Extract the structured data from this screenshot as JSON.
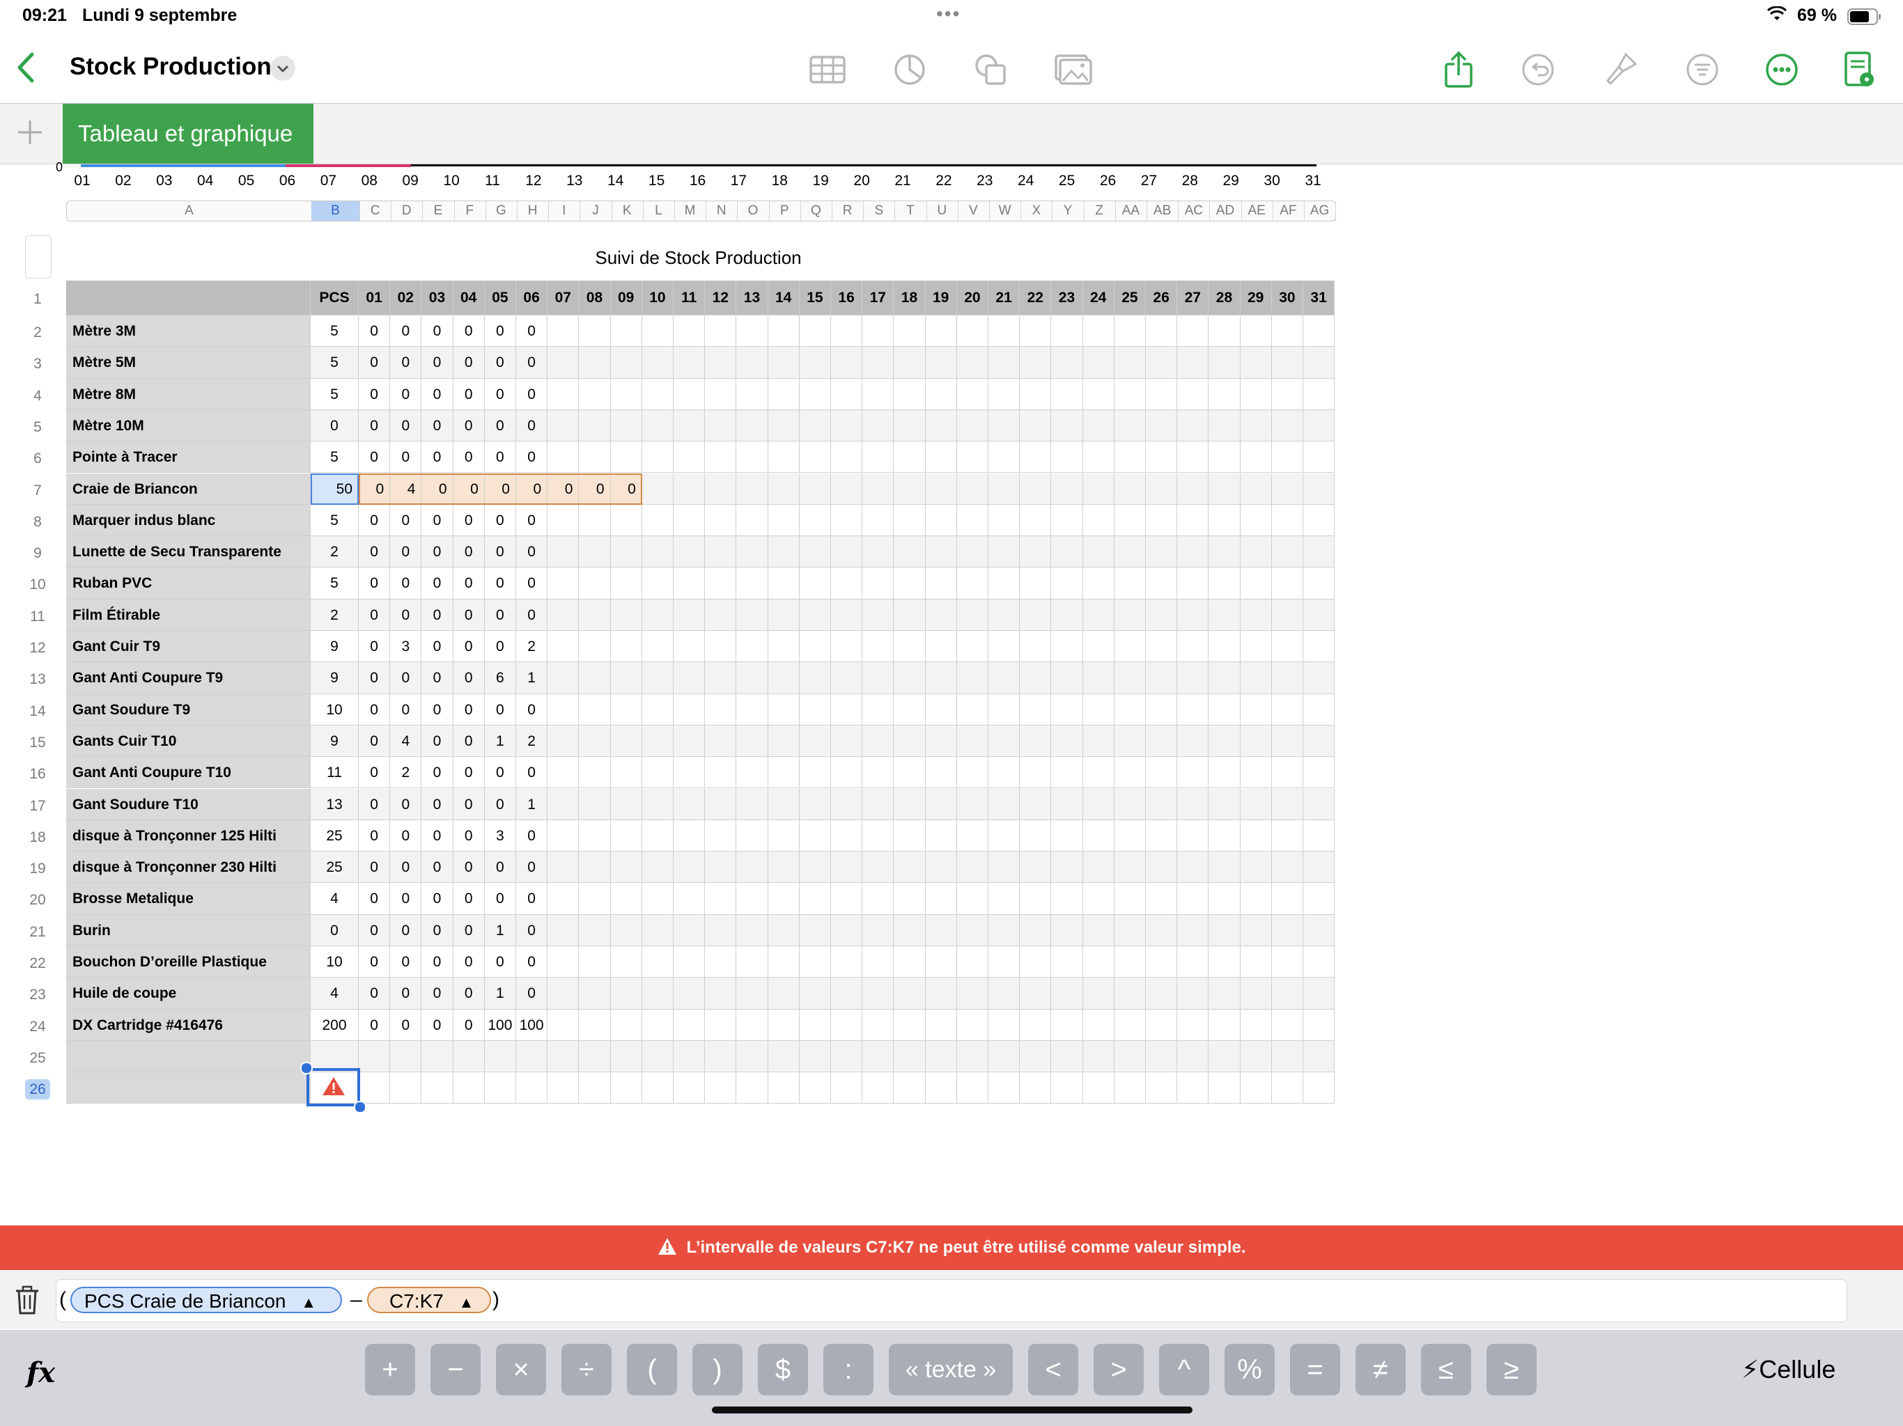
{
  "status_bar": {
    "time": "09:21",
    "date": "Lundi 9 septembre",
    "battery": "69 %"
  },
  "toolbar": {
    "document_title": "Stock Production"
  },
  "sheet_tabs": [
    {
      "label": "Tableau et graphique"
    }
  ],
  "chart_axis_ticks": [
    "01",
    "02",
    "03",
    "04",
    "05",
    "06",
    "07",
    "08",
    "09",
    "10",
    "11",
    "12",
    "13",
    "14",
    "15",
    "16",
    "17",
    "18",
    "19",
    "20",
    "21",
    "22",
    "23",
    "24",
    "25",
    "26",
    "27",
    "28",
    "29",
    "30",
    "31"
  ],
  "chart_axis_origin": "0",
  "column_letters": [
    "A",
    "B",
    "C",
    "D",
    "E",
    "F",
    "G",
    "H",
    "I",
    "J",
    "K",
    "L",
    "M",
    "N",
    "O",
    "P",
    "Q",
    "R",
    "S",
    "T",
    "U",
    "V",
    "W",
    "X",
    "Y",
    "Z",
    "AA",
    "AB",
    "AC",
    "AD",
    "AE",
    "AF",
    "AG"
  ],
  "selected_column": "B",
  "row_numbers": [
    "1",
    "2",
    "3",
    "4",
    "5",
    "6",
    "7",
    "8",
    "9",
    "10",
    "11",
    "12",
    "13",
    "14",
    "15",
    "16",
    "17",
    "18",
    "19",
    "20",
    "21",
    "22",
    "23",
    "24",
    "25",
    "26"
  ],
  "selected_row": "26",
  "table": {
    "title": "Suivi de Stock Production",
    "header": [
      "",
      "PCS",
      "01",
      "02",
      "03",
      "04",
      "05",
      "06",
      "07",
      "08",
      "09",
      "10",
      "11",
      "12",
      "13",
      "14",
      "15",
      "16",
      "17",
      "18",
      "19",
      "20",
      "21",
      "22",
      "23",
      "24",
      "25",
      "26",
      "27",
      "28",
      "29",
      "30",
      "31"
    ],
    "rows": [
      [
        "Mètre  3M",
        "5",
        "0",
        "0",
        "0",
        "0",
        "0",
        "0"
      ],
      [
        "Mètre  5M",
        "5",
        "0",
        "0",
        "0",
        "0",
        "0",
        "0"
      ],
      [
        "Mètre  8M",
        "5",
        "0",
        "0",
        "0",
        "0",
        "0",
        "0"
      ],
      [
        "Mètre  10M",
        "0",
        "0",
        "0",
        "0",
        "0",
        "0",
        "0"
      ],
      [
        "Pointe à Tracer",
        "5",
        "0",
        "0",
        "0",
        "0",
        "0",
        "0"
      ],
      [
        "Craie de Briancon",
        "50",
        "0",
        "4",
        "0",
        "0",
        "0",
        "0",
        "0",
        "0",
        "0"
      ],
      [
        "Marquer indus blanc",
        "5",
        "0",
        "0",
        "0",
        "0",
        "0",
        "0"
      ],
      [
        "Lunette de Secu Transparente",
        "2",
        "0",
        "0",
        "0",
        "0",
        "0",
        "0"
      ],
      [
        "Ruban PVC",
        "5",
        "0",
        "0",
        "0",
        "0",
        "0",
        "0"
      ],
      [
        "Film Étirable",
        "2",
        "0",
        "0",
        "0",
        "0",
        "0",
        "0"
      ],
      [
        "Gant Cuir T9",
        "9",
        "0",
        "3",
        "0",
        "0",
        "0",
        "2"
      ],
      [
        "Gant Anti Coupure T9",
        "9",
        "0",
        "0",
        "0",
        "0",
        "6",
        "1"
      ],
      [
        "Gant Soudure T9",
        "10",
        "0",
        "0",
        "0",
        "0",
        "0",
        "0"
      ],
      [
        "Gants Cuir T10",
        "9",
        "0",
        "4",
        "0",
        "0",
        "1",
        "2"
      ],
      [
        "Gant Anti Coupure T10",
        "11",
        "0",
        "2",
        "0",
        "0",
        "0",
        "0"
      ],
      [
        "Gant Soudure T10",
        "13",
        "0",
        "0",
        "0",
        "0",
        "0",
        "1"
      ],
      [
        " disque à Tronçonner 125 Hilti",
        "25",
        "0",
        "0",
        "0",
        "0",
        "3",
        "0"
      ],
      [
        " disque à Tronçonner 230 Hilti",
        "25",
        "0",
        "0",
        "0",
        "0",
        "0",
        "0"
      ],
      [
        "Brosse Metalique",
        "4",
        "0",
        "0",
        "0",
        "0",
        "0",
        "0"
      ],
      [
        "Burin",
        "0",
        "0",
        "0",
        "0",
        "0",
        "1",
        "0"
      ],
      [
        "Bouchon D’oreille Plastique",
        "10",
        "0",
        "0",
        "0",
        "0",
        "0",
        "0"
      ],
      [
        "Huile de coupe",
        "4",
        "0",
        "0",
        "0",
        "0",
        "1",
        "0"
      ],
      [
        "DX Cartridge #416476",
        "200",
        "0",
        "0",
        "0",
        "0",
        "100",
        "100"
      ],
      [
        ""
      ],
      [
        ""
      ]
    ]
  },
  "error_banner": {
    "message": "L’intervalle de valeurs C7:K7 ne peut être utilisé comme valeur simple.",
    "icon": "warning-icon"
  },
  "formula": {
    "open_paren": "(",
    "token_1": "PCS Craie de Briancon",
    "operator": "–",
    "token_2": "C7:K7",
    "close_paren": ")"
  },
  "keypad": {
    "fx": "fx",
    "keys": [
      "+",
      "−",
      "×",
      "÷",
      "(",
      ")",
      "$",
      ":",
      "« texte »",
      "<",
      ">",
      "^",
      "%",
      "=",
      "≠",
      "≤",
      "≥"
    ],
    "cell_button": "Cellule"
  },
  "colors": {
    "accent_green": "#3fa34d",
    "error_red": "#e84d3d",
    "ref_blue": "#4b84de",
    "ref_orange": "#d18a45",
    "chart_blue": "#3d8fe0",
    "chart_pink": "#d6336c"
  }
}
